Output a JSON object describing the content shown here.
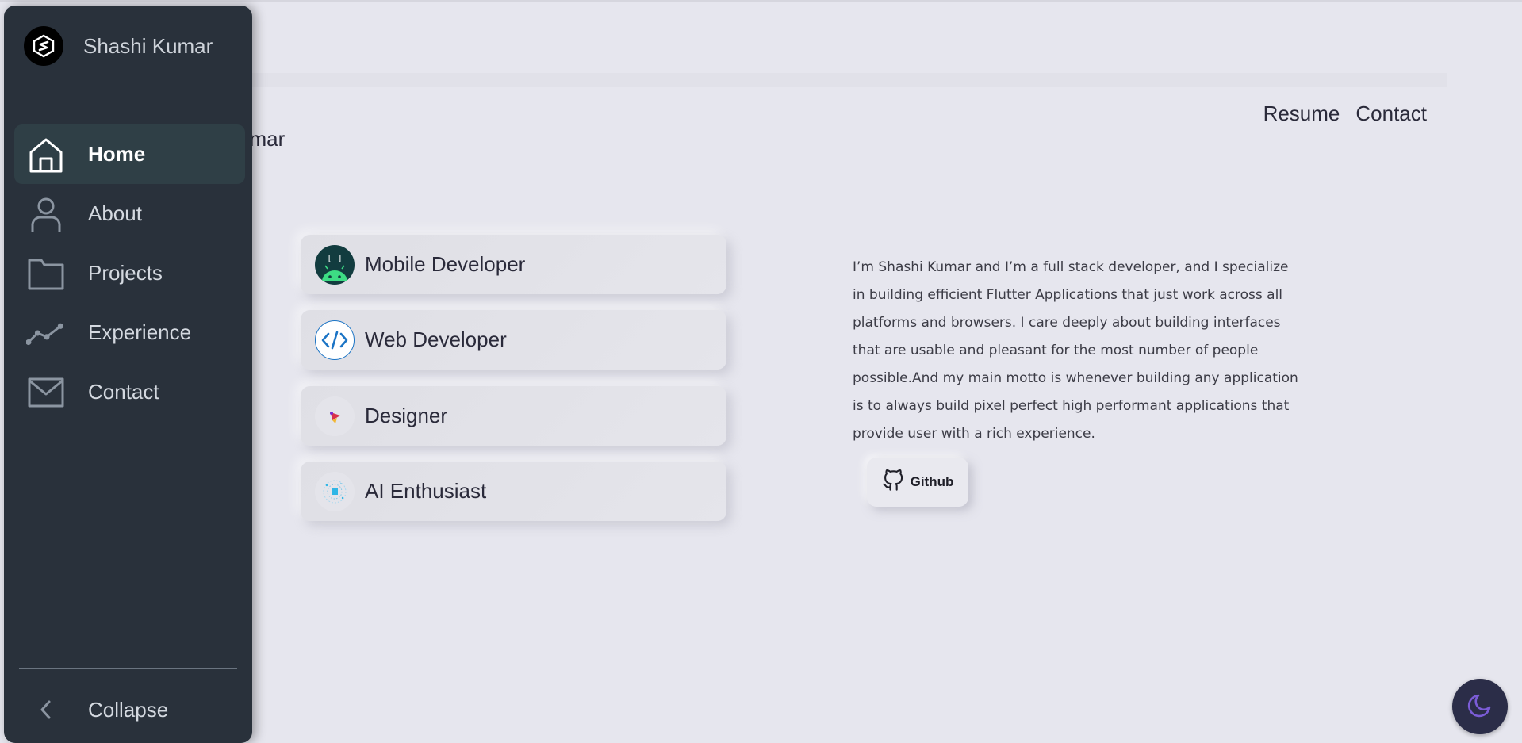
{
  "header": {
    "title_partial": "umar",
    "nav": [
      "Resume",
      "Contact"
    ]
  },
  "roles": [
    {
      "label": "Mobile Developer",
      "icon": "android-icon"
    },
    {
      "label": "Web Developer",
      "icon": "code-icon"
    },
    {
      "label": "Designer",
      "icon": "designer-icon"
    },
    {
      "label": "AI Enthusiast",
      "icon": "ai-brain-icon"
    }
  ],
  "bio": "I’m Shashi Kumar and I’m a full stack developer, and I specialize in building efficient Flutter Applications that just work across all platforms and browsers. I care deeply about building interfaces that are usable and pleasant for the most number of people possible.And my main motto is whenever building any application is to always build pixel perfect high performant applications that provide user with a rich experience.",
  "github": {
    "label": "Github"
  },
  "sidebar": {
    "brand_name": "Shashi Kumar",
    "items": [
      {
        "label": "Home",
        "icon": "home-icon",
        "active": true
      },
      {
        "label": "About",
        "icon": "user-icon",
        "active": false
      },
      {
        "label": "Projects",
        "icon": "folder-icon",
        "active": false
      },
      {
        "label": "Experience",
        "icon": "chart-line-icon",
        "active": false
      },
      {
        "label": "Contact",
        "icon": "mail-icon",
        "active": false
      }
    ],
    "collapse_label": "Collapse"
  },
  "colors": {
    "sidebar_bg": "#29313b",
    "sidebar_active": "#2f3f46",
    "page_bg": "#e6e6ee",
    "toggle_bg": "#2b2d48",
    "moon": "#7b5cd6"
  }
}
